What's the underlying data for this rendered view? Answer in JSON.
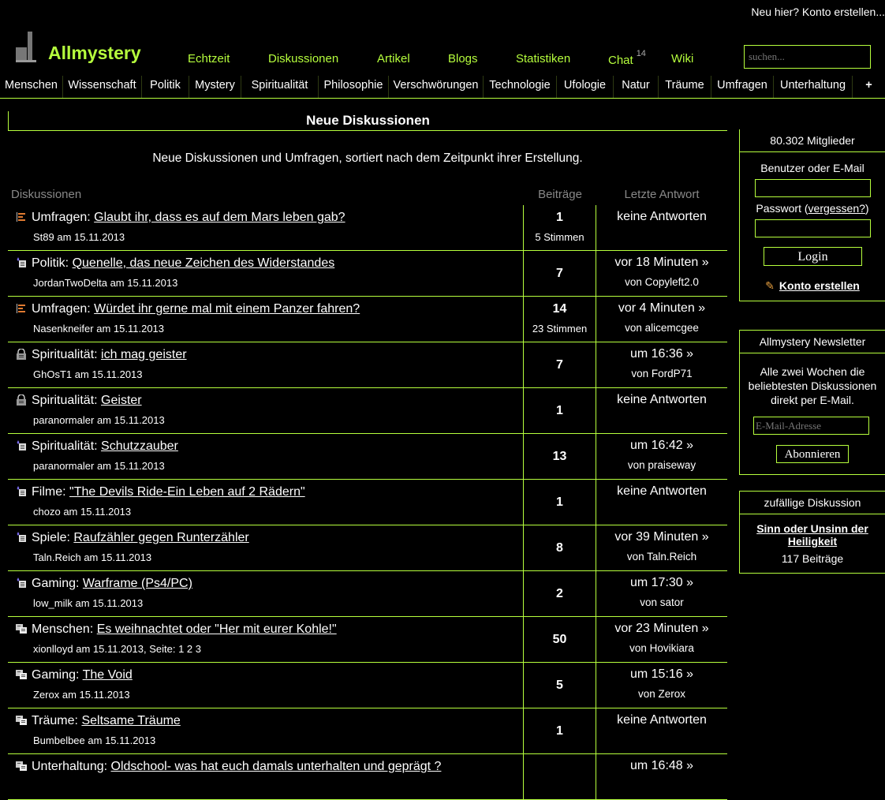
{
  "header": {
    "signup_link": "Neu hier? Konto erstellen...",
    "brand": "Allmystery",
    "search_placeholder": "suchen..."
  },
  "mainnav": [
    {
      "label": "Echtzeit"
    },
    {
      "label": "Diskussionen"
    },
    {
      "label": "Artikel"
    },
    {
      "label": "Blogs"
    },
    {
      "label": "Statistiken"
    },
    {
      "label": "Chat",
      "badge": "14"
    },
    {
      "label": "Wiki"
    }
  ],
  "categories": [
    "Menschen",
    "Wissenschaft",
    "Politik",
    "Mystery",
    "Spiritualität",
    "Philosophie",
    "Verschwörungen",
    "Technologie",
    "Ufologie",
    "Natur",
    "Träume",
    "Umfragen",
    "Unterhaltung",
    "+"
  ],
  "main": {
    "title": "Neue Diskussionen",
    "subtitle": "Neue Diskussionen und Umfragen, sortiert nach dem Zeitpunkt ihrer Erstellung.",
    "col_discussions": "Diskussionen",
    "col_posts": "Beiträge",
    "col_last": "Letzte Antwort"
  },
  "rows": [
    {
      "icon": "poll-icon",
      "cat": "Umfragen:",
      "title": "Glaubt ihr, dass es auf dem Mars leben gab?",
      "author": "St89",
      "date": "am 15.11.2013",
      "posts": "1",
      "votes": "5 Stimmen",
      "last": "keine Antworten",
      "by": ""
    },
    {
      "icon": "new-thread-icon",
      "cat": "Politik:",
      "title": "Quenelle, das neue Zeichen des Widerstandes ",
      "author": "JordanTwoDelta",
      "date": "am 15.11.2013",
      "posts": "7",
      "votes": "",
      "last": "vor 18 Minuten »",
      "by": "von Copyleft2.0"
    },
    {
      "icon": "poll-icon",
      "cat": "Umfragen:",
      "title": "Würdet ihr gerne mal mit einem Panzer fahren?",
      "author": "Nasenkneifer",
      "date": "am 15.11.2013",
      "posts": "14",
      "votes": "23 Stimmen",
      "last": "vor 4 Minuten »",
      "by": "von alicemcgee"
    },
    {
      "icon": "lock-icon",
      "cat": "Spiritualität:",
      "title": "ich mag geister",
      "author": "GhOsT1",
      "date": "am 15.11.2013",
      "posts": "7",
      "votes": "",
      "last": "um 16:36 »",
      "by": "von FordP71"
    },
    {
      "icon": "lock-icon",
      "cat": "Spiritualität:",
      "title": "Geister ",
      "author": "paranormaler",
      "date": "am 15.11.2013",
      "posts": "1",
      "votes": "",
      "last": "keine Antworten",
      "by": ""
    },
    {
      "icon": "new-thread-icon",
      "cat": "Spiritualität:",
      "title": "Schutzzauber",
      "author": "paranormaler",
      "date": "am 15.11.2013",
      "posts": "13",
      "votes": "",
      "last": "um 16:42 »",
      "by": "von praiseway"
    },
    {
      "icon": "new-thread-icon",
      "cat": "Filme:",
      "title": "\"The Devils Ride-Ein Leben auf 2 Rädern\"",
      "author": "chozo",
      "date": "am 15.11.2013",
      "posts": "1",
      "votes": "",
      "last": "keine Antworten",
      "by": ""
    },
    {
      "icon": "new-thread-icon",
      "cat": "Spiele:",
      "title": "Raufzähler gegen Runterzähler",
      "author": "Taln.Reich",
      "date": "am 15.11.2013",
      "posts": "8",
      "votes": "",
      "last": "vor 39 Minuten »",
      "by": "von Taln.Reich"
    },
    {
      "icon": "new-thread-icon",
      "cat": "Gaming:",
      "title": "Warframe (Ps4/PC)",
      "author": "low_milk",
      "date": "am 15.11.2013",
      "posts": "2",
      "votes": "",
      "last": "um 17:30 »",
      "by": "von sator"
    },
    {
      "icon": "hot-thread-icon",
      "cat": "Menschen:",
      "title": "Es weihnachtet oder \"Her mit eurer Kohle!\"",
      "author": "xionlloyd",
      "date": "am 15.11.2013, Seite: 1 2 3",
      "posts": "50",
      "votes": "",
      "last": "vor 23 Minuten »",
      "by": "von Hovikiara"
    },
    {
      "icon": "hot-thread-icon",
      "cat": "Gaming:",
      "title": "The Void",
      "author": "Zerox",
      "date": "am 15.11.2013",
      "posts": "5",
      "votes": "",
      "last": "um 15:16 »",
      "by": "von Zerox"
    },
    {
      "icon": "hot-thread-icon",
      "cat": "Träume:",
      "title": "Seltsame Träume",
      "author": "Bumbelbee",
      "date": "am 15.11.2013",
      "posts": "1",
      "votes": "",
      "last": "keine Antworten",
      "by": ""
    },
    {
      "icon": "hot-thread-icon",
      "cat": "Unterhaltung:",
      "title": "Oldschool- was hat euch damals unterhalten und geprägt ?",
      "author": "",
      "date": "",
      "posts": "",
      "votes": "",
      "last": "um 16:48 »",
      "by": ""
    }
  ],
  "sidebar": {
    "members": "80.302 Mitglieder",
    "user_label": "Benutzer oder E-Mail",
    "pw_label": "Passwort (",
    "pw_forgot": "vergessen?",
    "pw_close": ")",
    "login": "Login",
    "create_account": "Konto erstellen",
    "newsletter_title": "Allmystery Newsletter",
    "newsletter_text": "Alle zwei Wochen die beliebtesten Diskussionen direkt per E-Mail.",
    "email_placeholder": "E-Mail-Adresse",
    "subscribe": "Abonnieren",
    "random_title": "zufällige Diskussion",
    "random_link": "Sinn oder Unsinn der Heiligkeit",
    "random_posts": "117 Beiträge"
  },
  "colors": {
    "accent": "#b6ff3d",
    "background": "#000000"
  }
}
